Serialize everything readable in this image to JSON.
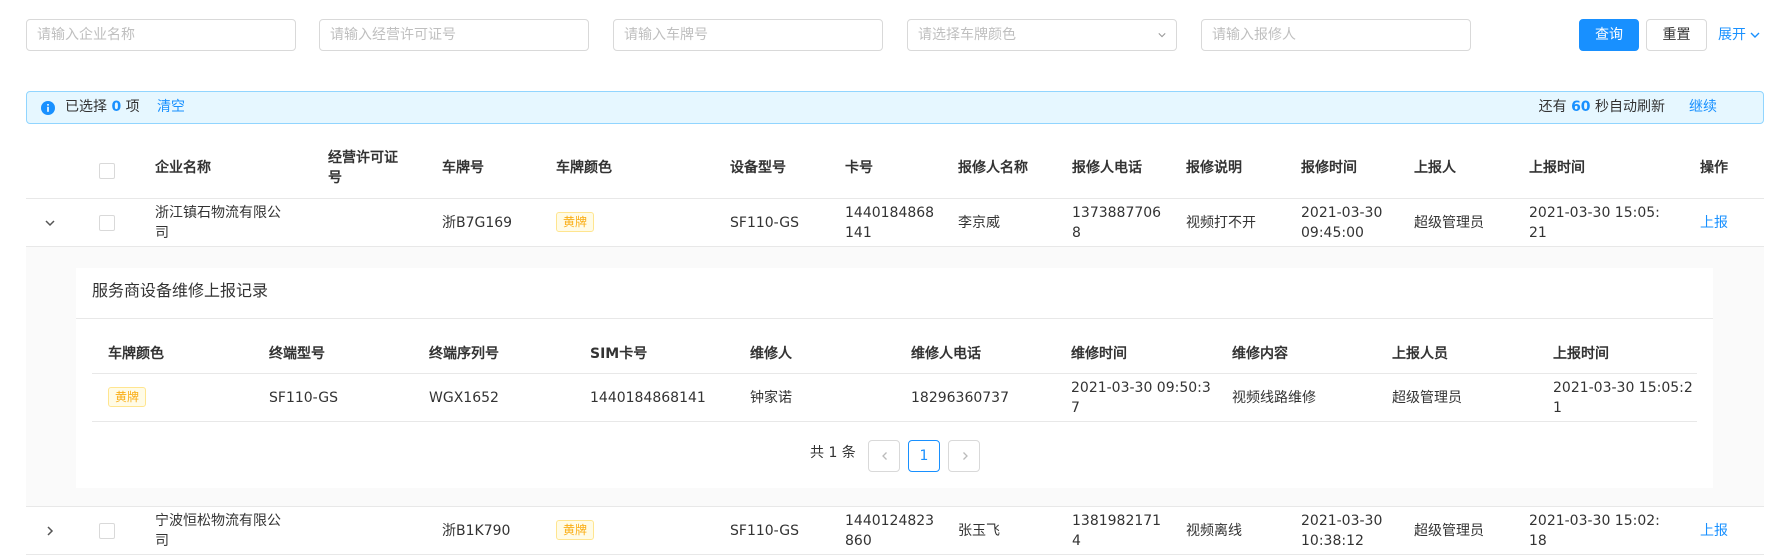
{
  "filters": {
    "company_placeholder": "请输入企业名称",
    "license_placeholder": "请输入经营许可证号",
    "plate_placeholder": "请输入车牌号",
    "plate_color_placeholder": "请选择车牌颜色",
    "reporter_placeholder": "请输入报修人",
    "query_label": "查询",
    "reset_label": "重置",
    "expand_label": "展开"
  },
  "alert": {
    "selected_prefix": "已选择",
    "selected_count": "0",
    "selected_suffix": "项",
    "clear_label": "清空",
    "refresh_prefix": "还有",
    "refresh_seconds": "60",
    "refresh_suffix": "秒自动刷新",
    "continue_label": "继续",
    "accent": "#1890ff"
  },
  "table": {
    "columns": [
      "企业名称",
      "经营许可证号",
      "车牌号",
      "车牌颜色",
      "设备型号",
      "卡号",
      "报修人名称",
      "报修人电话",
      "报修说明",
      "报修时间",
      "上报人",
      "上报时间",
      "操作"
    ],
    "license_col_line1": "经营许可证",
    "license_col_line2": "号",
    "rows": [
      {
        "company_l1": "浙江镇石物流有限公",
        "company_l2": "司",
        "license": "",
        "plate": "浙B7G169",
        "plate_color": "黄牌",
        "device": "SF110-GS",
        "card_l1": "1440184868",
        "card_l2": "141",
        "reporter": "李京威",
        "phone_l1": "1373887706",
        "phone_l2": "8",
        "desc": "视频打不开",
        "repair_time_l1": "2021-03-30",
        "repair_time_l2": "09:45:00",
        "submitter": "超级管理员",
        "submit_time_l1": "2021-03-30 15:05:",
        "submit_time_l2": "21",
        "action": "上报"
      },
      {
        "company_l1": "宁波恒松物流有限公",
        "company_l2": "司",
        "license": "",
        "plate": "浙B1K790",
        "plate_color": "黄牌",
        "device": "SF110-GS",
        "card_l1": "1440124823",
        "card_l2": "860",
        "reporter": "张玉飞",
        "phone_l1": "1381982171",
        "phone_l2": "4",
        "desc": "视频离线",
        "repair_time_l1": "2021-03-30",
        "repair_time_l2": "10:38:12",
        "submitter": "超级管理员",
        "submit_time_l1": "2021-03-30 15:02:",
        "submit_time_l2": "18",
        "action": "上报"
      }
    ]
  },
  "subtable": {
    "title": "服务商设备维修上报记录",
    "columns": [
      "车牌颜色",
      "终端型号",
      "终端序列号",
      "SIM卡号",
      "维修人",
      "维修人电话",
      "维修时间",
      "维修内容",
      "上报人员",
      "上报时间"
    ],
    "rows": [
      {
        "plate_color": "黄牌",
        "terminal_model": "SF110-GS",
        "terminal_serial": "WGX1652",
        "sim": "1440184868141",
        "repairer": "钟家诺",
        "repairer_phone": "18296360737",
        "repair_time_l1": "2021-03-30 09:50:3",
        "repair_time_l2": "7",
        "content": "视频线路维修",
        "submitter": "超级管理员",
        "submit_time_l1": "2021-03-30 15:05:2",
        "submit_time_l2": "1"
      }
    ],
    "pager": {
      "total_text": "共 1 条",
      "current_page": "1"
    }
  }
}
